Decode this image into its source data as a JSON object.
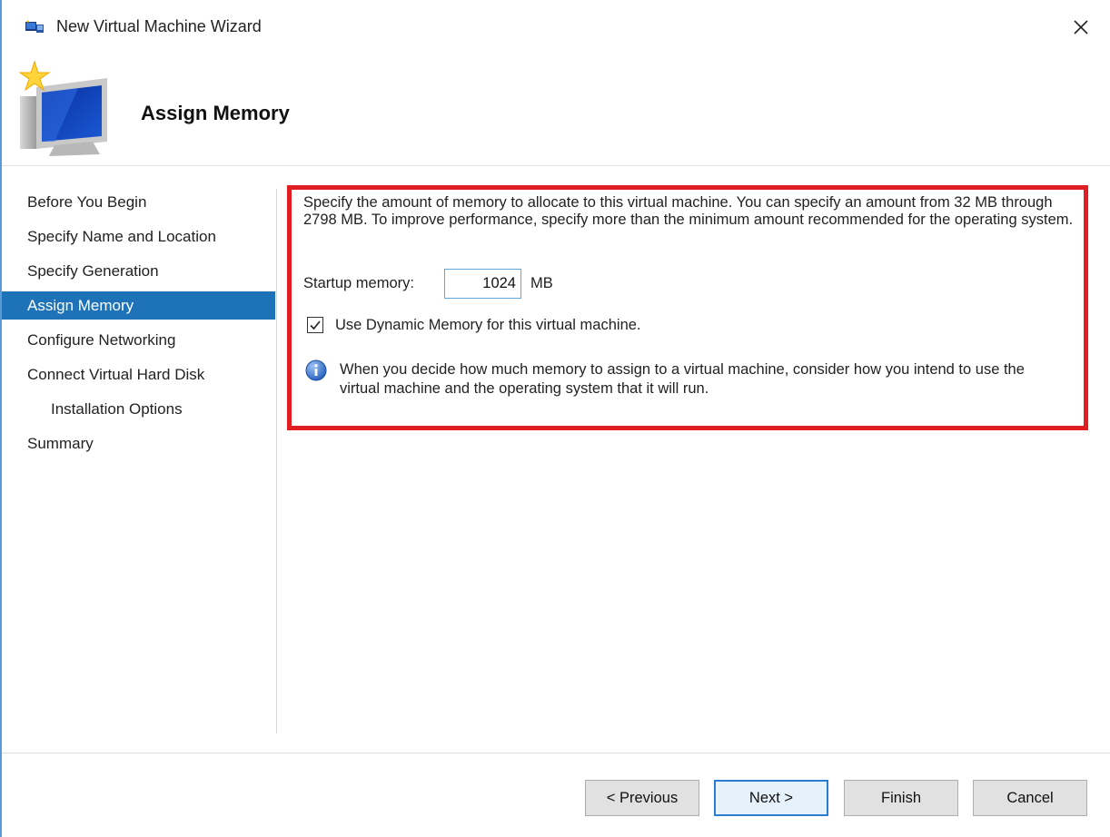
{
  "window": {
    "title": "New Virtual Machine Wizard",
    "close_icon": "close-icon",
    "app_icon": "virtual-machine-icon"
  },
  "header": {
    "title": "Assign Memory",
    "icon": "new-computer-icon"
  },
  "nav": {
    "items": [
      {
        "label": "Before You Begin",
        "active": false,
        "sub": false
      },
      {
        "label": "Specify Name and Location",
        "active": false,
        "sub": false
      },
      {
        "label": "Specify Generation",
        "active": false,
        "sub": false
      },
      {
        "label": "Assign Memory",
        "active": true,
        "sub": false
      },
      {
        "label": "Configure Networking",
        "active": false,
        "sub": false
      },
      {
        "label": "Connect Virtual Hard Disk",
        "active": false,
        "sub": false
      },
      {
        "label": "Installation Options",
        "active": false,
        "sub": true
      },
      {
        "label": "Summary",
        "active": false,
        "sub": false
      }
    ]
  },
  "content": {
    "description": "Specify the amount of memory to allocate to this virtual machine. You can specify an amount from 32 MB through 2798 MB. To improve performance, specify more than the minimum amount recommended for the operating system.",
    "startup_memory_label": "Startup memory:",
    "startup_memory_value": "1024",
    "startup_memory_unit": "MB",
    "dynamic_memory_label": "Use Dynamic Memory for this virtual machine.",
    "dynamic_memory_checked": true,
    "info_icon": "info-icon",
    "info_text": "When you decide how much memory to assign to a virtual machine, consider how you intend to use the virtual machine and the operating system that it will run."
  },
  "buttons": {
    "previous": "< Previous",
    "next": "Next >",
    "finish": "Finish",
    "cancel": "Cancel"
  },
  "colors": {
    "selection": "#1e73b8",
    "highlight_border": "#e01e24",
    "default_button_border": "#2a7dd0"
  }
}
